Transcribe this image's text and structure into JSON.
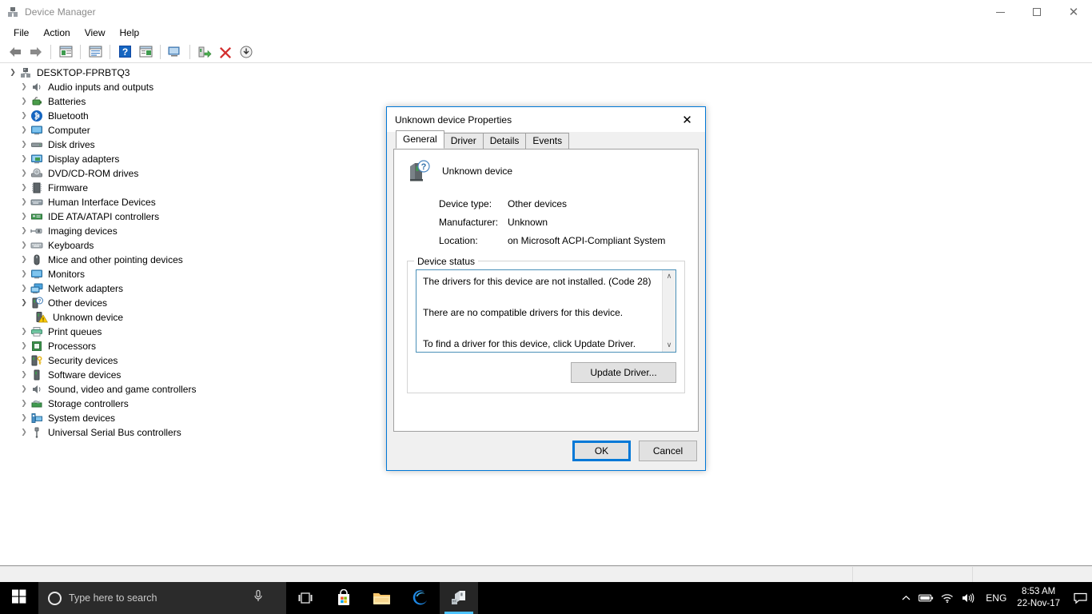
{
  "window": {
    "title": "Device Manager",
    "icon": "device-manager-icon",
    "buttons": {
      "minimize": "minimize",
      "maximize": "restore",
      "close": "close"
    }
  },
  "menubar": {
    "items": [
      "File",
      "Action",
      "View",
      "Help"
    ]
  },
  "toolbar": {
    "items": [
      {
        "name": "back-icon",
        "tip": "Back"
      },
      {
        "name": "forward-icon",
        "tip": "Forward"
      },
      {
        "name": "show-hide-console-tree-icon",
        "tip": "Show/Hide Console Tree"
      },
      {
        "name": "properties-icon",
        "tip": "Properties"
      },
      {
        "name": "help-icon",
        "tip": "Help"
      },
      {
        "name": "show-hide-action-pane-icon",
        "tip": "Show/Hide Action Pane"
      },
      {
        "name": "scan-for-hardware-changes-icon",
        "tip": "Scan for hardware changes"
      },
      {
        "name": "update-driver-icon",
        "tip": "Update Driver"
      },
      {
        "name": "uninstall-device-icon",
        "tip": "Uninstall device"
      },
      {
        "name": "disable-device-icon",
        "tip": "Disable device"
      }
    ]
  },
  "tree": {
    "root": {
      "label": "DESKTOP-FPRBTQ3",
      "expanded": true,
      "icon": "computer-root-icon"
    },
    "items": [
      {
        "label": "Audio inputs and outputs",
        "icon": "speaker-icon",
        "expanded": false,
        "level": 1
      },
      {
        "label": "Batteries",
        "icon": "battery-icon",
        "expanded": false,
        "level": 1
      },
      {
        "label": "Bluetooth",
        "icon": "bluetooth-icon",
        "expanded": false,
        "level": 1
      },
      {
        "label": "Computer",
        "icon": "monitor-icon",
        "expanded": false,
        "level": 1
      },
      {
        "label": "Disk drives",
        "icon": "disk-drive-icon",
        "expanded": false,
        "level": 1
      },
      {
        "label": "Display adapters",
        "icon": "display-adapter-icon",
        "expanded": false,
        "level": 1
      },
      {
        "label": "DVD/CD-ROM drives",
        "icon": "optical-drive-icon",
        "expanded": false,
        "level": 1
      },
      {
        "label": "Firmware",
        "icon": "firmware-chip-icon",
        "expanded": false,
        "level": 1
      },
      {
        "label": "Human Interface Devices",
        "icon": "hid-icon",
        "expanded": false,
        "level": 1
      },
      {
        "label": "IDE ATA/ATAPI controllers",
        "icon": "ide-controller-icon",
        "expanded": false,
        "level": 1
      },
      {
        "label": "Imaging devices",
        "icon": "camera-icon",
        "expanded": false,
        "level": 1
      },
      {
        "label": "Keyboards",
        "icon": "keyboard-icon",
        "expanded": false,
        "level": 1
      },
      {
        "label": "Mice and other pointing devices",
        "icon": "mouse-icon",
        "expanded": false,
        "level": 1
      },
      {
        "label": "Monitors",
        "icon": "monitor-icon",
        "expanded": false,
        "level": 1
      },
      {
        "label": "Network adapters",
        "icon": "network-adapter-icon",
        "expanded": false,
        "level": 1
      },
      {
        "label": "Other devices",
        "icon": "other-devices-icon",
        "expanded": true,
        "level": 1
      },
      {
        "label": "Unknown device",
        "icon": "unknown-device-warning-icon",
        "expanded": null,
        "level": 2,
        "selected": false
      },
      {
        "label": "Print queues",
        "icon": "printer-icon",
        "expanded": false,
        "level": 1
      },
      {
        "label": "Processors",
        "icon": "processor-icon",
        "expanded": false,
        "level": 1
      },
      {
        "label": "Security devices",
        "icon": "security-device-icon",
        "expanded": false,
        "level": 1
      },
      {
        "label": "Software devices",
        "icon": "software-device-icon",
        "expanded": false,
        "level": 1
      },
      {
        "label": "Sound, video and game controllers",
        "icon": "speaker-icon",
        "expanded": false,
        "level": 1
      },
      {
        "label": "Storage controllers",
        "icon": "storage-controller-icon",
        "expanded": false,
        "level": 1
      },
      {
        "label": "System devices",
        "icon": "system-device-icon",
        "expanded": false,
        "level": 1
      },
      {
        "label": "Universal Serial Bus controllers",
        "icon": "usb-controller-icon",
        "expanded": false,
        "level": 1
      }
    ]
  },
  "statusbar": {
    "text": ""
  },
  "dialog": {
    "title": "Unknown device Properties",
    "close_label": "✕",
    "tabs": [
      {
        "label": "General",
        "active": true
      },
      {
        "label": "Driver",
        "active": false
      },
      {
        "label": "Details",
        "active": false
      },
      {
        "label": "Events",
        "active": false
      }
    ],
    "device_name": "Unknown device",
    "device_icon": "unknown-device-icon",
    "properties": [
      {
        "label": "Device type:",
        "value": "Other devices"
      },
      {
        "label": "Manufacturer:",
        "value": "Unknown"
      },
      {
        "label": "Location:",
        "value": "on Microsoft ACPI-Compliant System"
      }
    ],
    "device_status": {
      "group_title": "Device status",
      "lines": [
        "The drivers for this device are not installed. (Code 28)",
        "There are no compatible drivers for this device.",
        "To find a driver for this device, click Update Driver."
      ],
      "scroll_up": "∧",
      "scroll_down": "∨"
    },
    "update_driver_label": "Update Driver...",
    "ok_label": "OK",
    "cancel_label": "Cancel"
  },
  "taskbar": {
    "start_icon": "windows-start-icon",
    "search_placeholder": "Type here to search",
    "cortana_icon": "cortana-circle-icon",
    "mic_icon": "microphone-icon",
    "apps": [
      {
        "name": "task-view-icon",
        "label": "Task View",
        "active": false
      },
      {
        "name": "microsoft-store-icon",
        "label": "Microsoft Store",
        "active": false
      },
      {
        "name": "file-explorer-icon",
        "label": "File Explorer",
        "active": false
      },
      {
        "name": "microsoft-edge-icon",
        "label": "Microsoft Edge",
        "active": false
      },
      {
        "name": "device-manager-taskbar-icon",
        "label": "Device Manager",
        "active": true
      }
    ],
    "tray": {
      "chevron": "∧",
      "battery_icon": "battery-tray-icon",
      "network_icon": "wifi-tray-icon",
      "volume_icon": "volume-tray-icon",
      "language": "ENG",
      "time": "8:53 AM",
      "date": "22-Nov-17",
      "action_center_icon": "action-center-icon"
    }
  },
  "colors": {
    "accent": "#0078d7",
    "dialog_border": "#0078d7",
    "status_box_border": "#4a90b8",
    "taskbar_bg": "#000000",
    "search_bg": "#2b2b2b",
    "warning_yellow": "#ffcc00",
    "title_text": "#8a8a8a"
  }
}
